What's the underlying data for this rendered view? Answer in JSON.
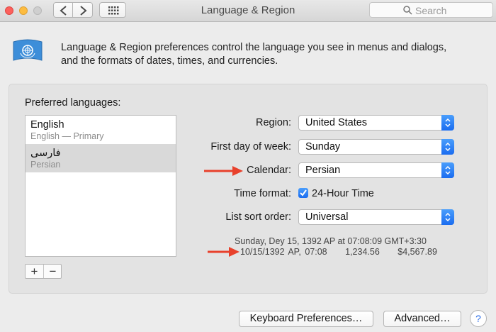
{
  "window": {
    "title": "Language & Region",
    "search_placeholder": "Search"
  },
  "header": {
    "intro_line1": "Language & Region preferences control the language you see in menus and dialogs,",
    "intro_line2": "and the formats of dates, times, and currencies."
  },
  "preferred_languages": {
    "label": "Preferred languages:",
    "items": [
      {
        "name": "English",
        "subtitle": "English — Primary"
      },
      {
        "name": "فارسی",
        "subtitle": "Persian"
      }
    ],
    "add_label": "+",
    "remove_label": "−"
  },
  "settings": {
    "region_label": "Region:",
    "region_value": "United States",
    "first_day_label": "First day of week:",
    "first_day_value": "Sunday",
    "calendar_label": "Calendar:",
    "calendar_value": "Persian",
    "time_format_label": "Time format:",
    "time_format_value": "24-Hour Time",
    "time_format_checked": true,
    "sort_order_label": "List sort order:",
    "sort_order_value": "Universal"
  },
  "sample": {
    "line1": "Sunday, Dey 15, 1392 AP at 07:08:09 GMT+3:30",
    "date_short": "10/15/1392 AP, 07:08",
    "number": "1,234.56",
    "currency": "$4,567.89"
  },
  "buttons": {
    "keyboard": "Keyboard Preferences…",
    "advanced": "Advanced…",
    "help": "?"
  },
  "colors": {
    "accent": "#1a6cf0",
    "arrow": "#e8412c"
  }
}
